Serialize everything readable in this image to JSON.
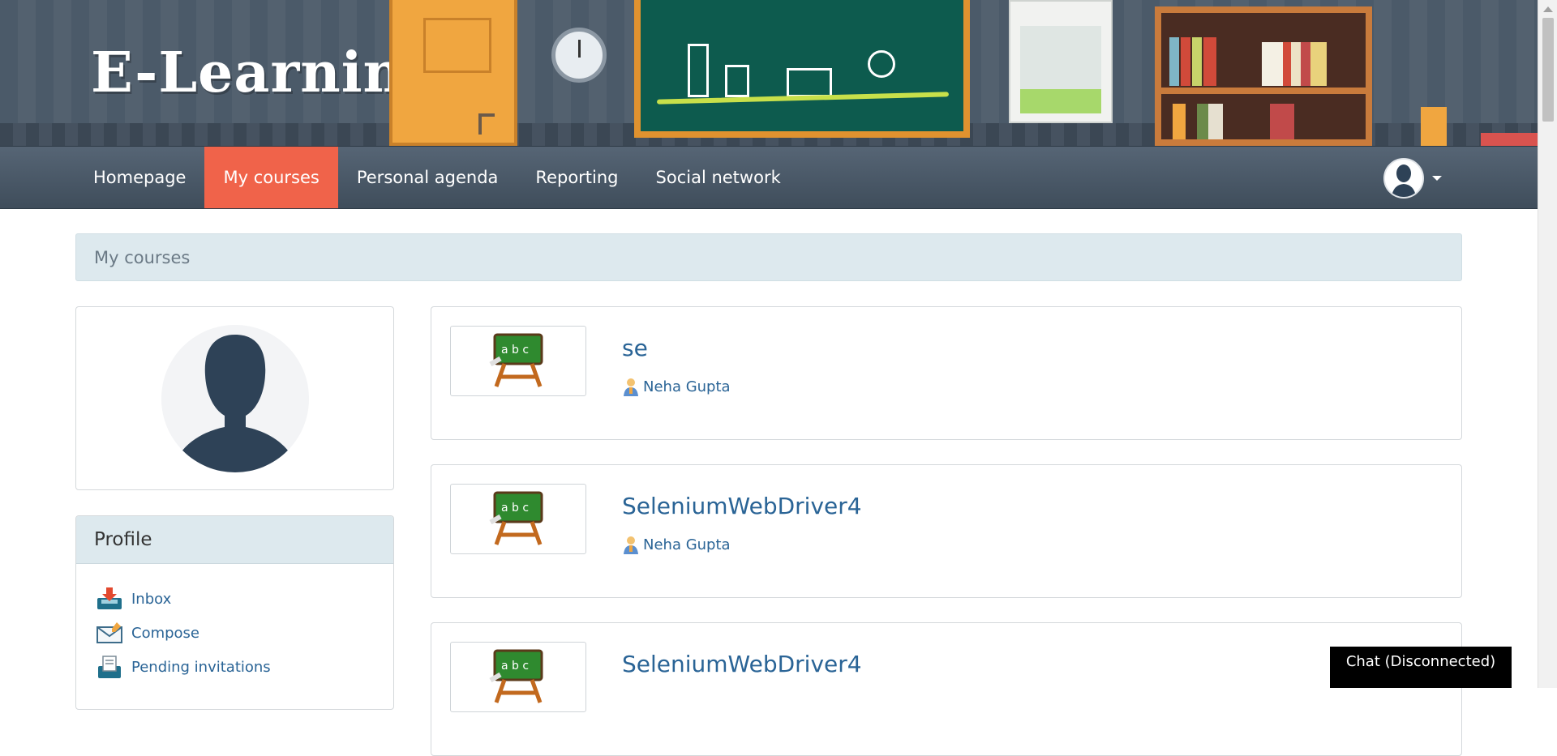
{
  "header": {
    "logo_text": "E-Learning"
  },
  "nav": {
    "items": [
      {
        "label": "Homepage",
        "active": false
      },
      {
        "label": "My courses",
        "active": true
      },
      {
        "label": "Personal agenda",
        "active": false
      },
      {
        "label": "Reporting",
        "active": false
      },
      {
        "label": "Social network",
        "active": false
      }
    ],
    "active_color": "#f0634a",
    "user_menu_icon": "user-avatar-icon"
  },
  "breadcrumb": {
    "text": "My courses"
  },
  "profile": {
    "title": "Profile",
    "links": [
      {
        "label": "Inbox",
        "icon": "inbox-icon"
      },
      {
        "label": "Compose",
        "icon": "compose-icon"
      },
      {
        "label": "Pending invitations",
        "icon": "invitations-icon"
      }
    ]
  },
  "courses": [
    {
      "title": "se",
      "teacher": "Neha Gupta",
      "icon": "blackboard-icon"
    },
    {
      "title": "SeleniumWebDriver4",
      "teacher": "Neha Gupta",
      "icon": "blackboard-icon"
    },
    {
      "title": "SeleniumWebDriver4",
      "teacher": "",
      "icon": "blackboard-icon"
    }
  ],
  "chat": {
    "label": "Chat (Disconnected)"
  },
  "colors": {
    "link": "#2a6496",
    "banner": "#4b5a69",
    "panel_header": "#dde9ee"
  }
}
